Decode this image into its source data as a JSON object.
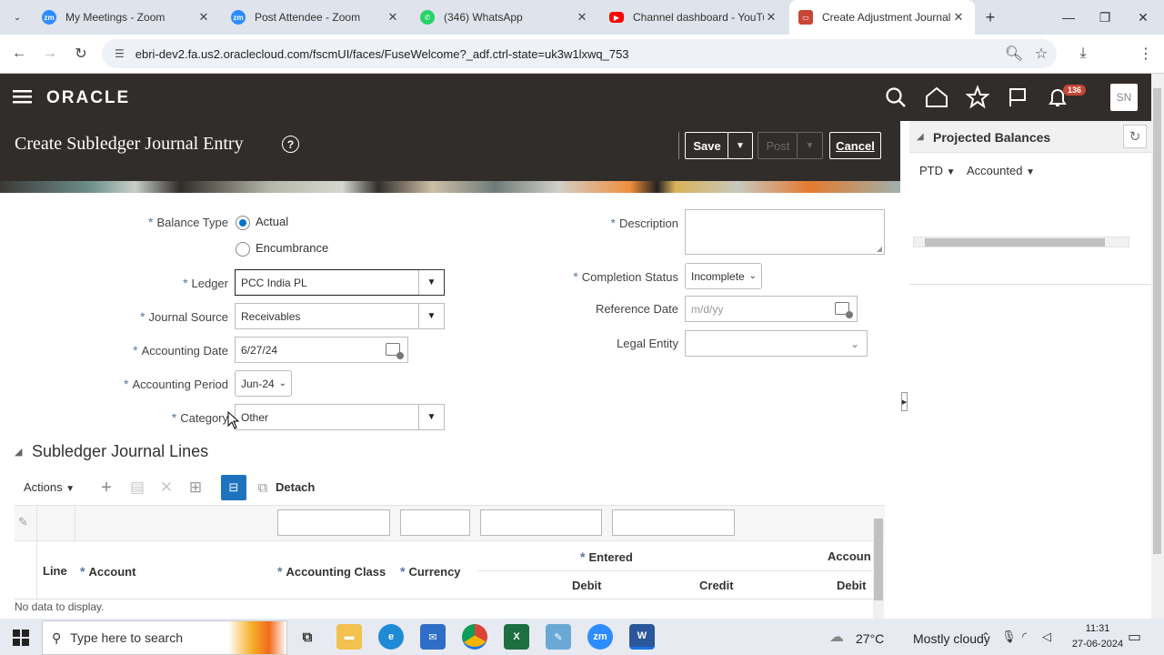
{
  "browser": {
    "tabs": [
      {
        "title": "My Meetings - Zoom",
        "favicon": "zoom-icon",
        "color": "#2d8cff",
        "active": false
      },
      {
        "title": "Post Attendee - Zoom",
        "favicon": "zoom-icon",
        "color": "#2d8cff",
        "active": false
      },
      {
        "title": "(346) WhatsApp",
        "favicon": "whatsapp-icon",
        "color": "#25d366",
        "active": false
      },
      {
        "title": "Channel dashboard - YouTu",
        "favicon": "youtube-icon",
        "color": "#ff0000",
        "active": false
      },
      {
        "title": "Create Adjustment Journal -",
        "favicon": "oracle-icon",
        "color": "#c74634",
        "active": true
      }
    ],
    "url": "ebri-dev2.fa.us2.oraclecloud.com/fscmUI/faces/FuseWelcome?_adf.ctrl-state=uk3w1lxwq_753"
  },
  "header": {
    "logo": "ORACLE",
    "notifications_count": "136",
    "user_initials": "SN"
  },
  "page": {
    "title": "Create Subledger Journal Entry",
    "save_label": "Save",
    "post_label": "Post",
    "cancel_label": "Cancel"
  },
  "form": {
    "balance_type_label": "Balance Type",
    "balance_type_options": [
      "Actual",
      "Encumbrance"
    ],
    "balance_type_selected": "Actual",
    "ledger_label": "Ledger",
    "ledger_value": "PCC India PL",
    "journal_source_label": "Journal Source",
    "journal_source_value": "Receivables",
    "accounting_date_label": "Accounting Date",
    "accounting_date_value": "6/27/24",
    "accounting_period_label": "Accounting Period",
    "accounting_period_value": "Jun-24",
    "category_label": "Category",
    "category_value": "Other",
    "description_label": "Description",
    "description_value": "",
    "completion_status_label": "Completion Status",
    "completion_status_value": "Incomplete",
    "reference_date_label": "Reference Date",
    "reference_date_placeholder": "m/d/yy",
    "legal_entity_label": "Legal Entity",
    "legal_entity_value": ""
  },
  "projected_balances": {
    "title": "Projected Balances",
    "ptd_label": "PTD",
    "accounted_label": "Accounted"
  },
  "journal_lines": {
    "title": "Subledger Journal Lines",
    "actions_label": "Actions",
    "detach_label": "Detach",
    "columns": {
      "line": "Line",
      "account": "Account",
      "accounting_class": "Accounting Class",
      "currency": "Currency",
      "entered": "Entered",
      "entered_debit": "Debit",
      "entered_credit": "Credit",
      "accounted": "Accoun",
      "accounted_debit": "Debit"
    },
    "empty_message": "No data to display."
  },
  "taskbar": {
    "search_placeholder": "Type here to search",
    "weather_temp": "27°C",
    "weather_text": "Mostly cloudy",
    "time": "11:31",
    "date": "27-06-2024"
  }
}
